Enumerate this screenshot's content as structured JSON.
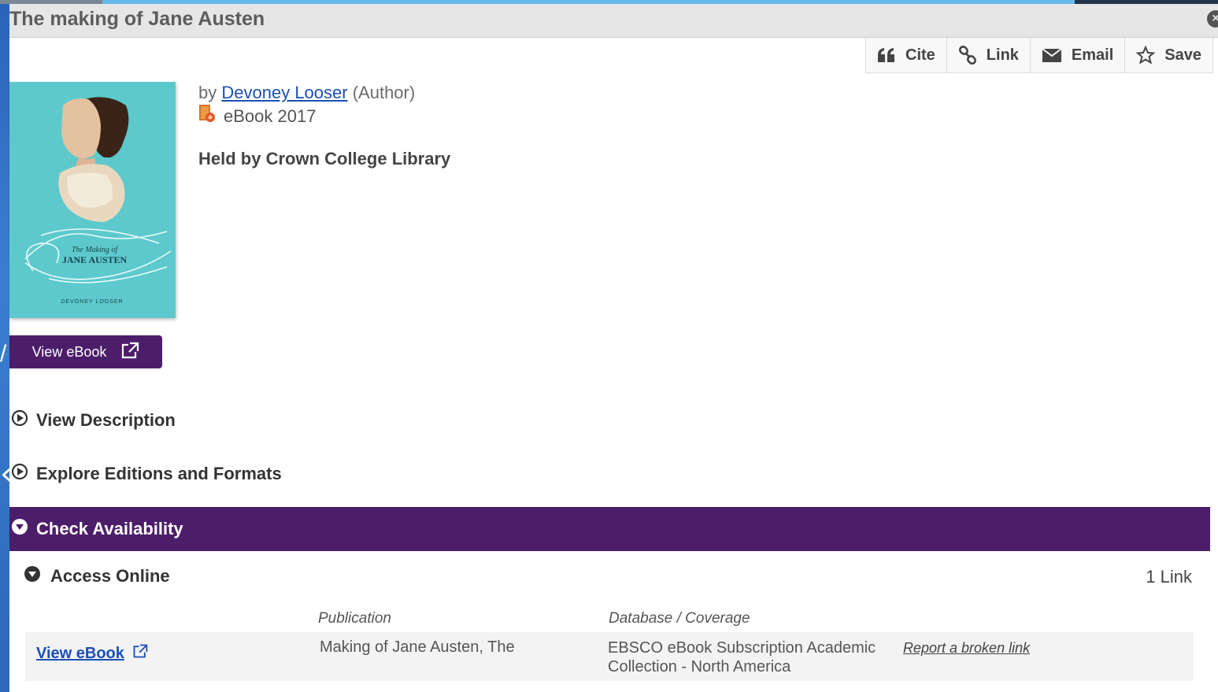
{
  "window": {
    "title": "The making of Jane Austen",
    "close_icon": "close-icon"
  },
  "toolbar": {
    "items": [
      {
        "label": "Cite",
        "icon": "quote-icon"
      },
      {
        "label": "Link",
        "icon": "link-icon"
      },
      {
        "label": "Email",
        "icon": "envelope-icon"
      },
      {
        "label": "Save",
        "icon": "star-icon"
      }
    ]
  },
  "record": {
    "by_prefix": "by",
    "author": "Devoney Looser",
    "author_role": "(Author)",
    "format": "eBook 2017",
    "format_icon": "ebook-icon",
    "held_by": "Held by Crown College Library",
    "cover": {
      "title_line1": "The Making of",
      "title_line2": "JANE AUSTEN",
      "author": "DEVONEY LOOSER",
      "bg_color": "#5ec9cc"
    },
    "view_button": "View eBook"
  },
  "sections": {
    "view_description": "View Description",
    "explore_editions": "Explore Editions and Formats",
    "check_availability": "Check Availability",
    "access_online": "Access Online",
    "link_count": "1 Link"
  },
  "availability": {
    "columns": {
      "publication": "Publication",
      "database": "Database / Coverage"
    },
    "rows": [
      {
        "link": "View eBook",
        "publication": "Making of Jane Austen, The",
        "database": "EBSCO eBook Subscription Academic Collection - North America",
        "report": "Report a broken link"
      }
    ]
  },
  "colors": {
    "accent_purple": "#4c1e6a",
    "link_blue": "#1a4fb7",
    "title_bar": "#e6e6e6"
  }
}
